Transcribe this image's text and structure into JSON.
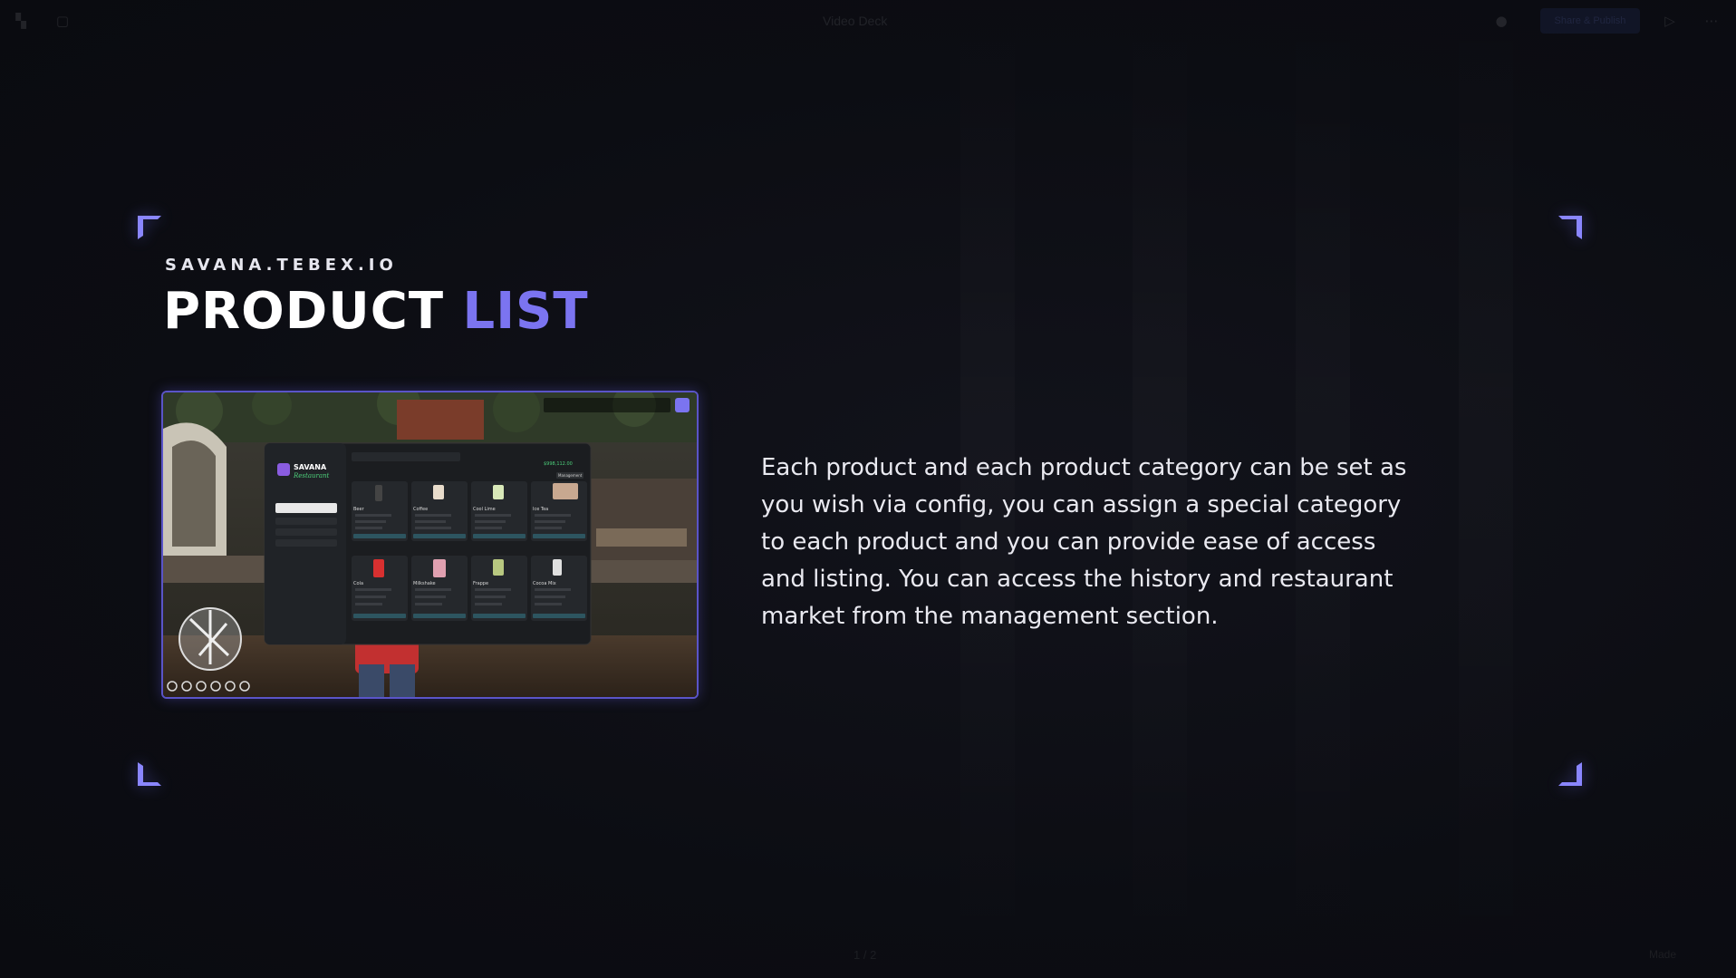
{
  "top_bar": {
    "doc_title": "Video Deck",
    "share_label": "Share & Publish"
  },
  "bottom_bar": {
    "page_indicator": "1 / 2",
    "brand": "Made"
  },
  "slide": {
    "eyebrow": "SAVANA.TEBEX.IO",
    "title_part1": "PRODUCT",
    "title_part2": "LIST",
    "description": "Each product and each product category can be set as you wish via config, you can assign a special category to each product and you can provide ease of access and listing. You can access the history and restaurant market from the management section."
  },
  "screenshot": {
    "logo_line1": "SAVANA",
    "logo_line2": "Restaurant",
    "categories": [
      "Beer",
      "Coffee",
      "Cool Lime",
      "Ice Tea",
      "Cola",
      "Milkshake",
      "Frappe",
      "Cocoa Mix"
    ],
    "balance_value": "$998,112.00",
    "management_label": "Management"
  },
  "colors": {
    "accent": "#7b74f0",
    "corner": "#8a86ff",
    "background": "#0d0e14"
  }
}
